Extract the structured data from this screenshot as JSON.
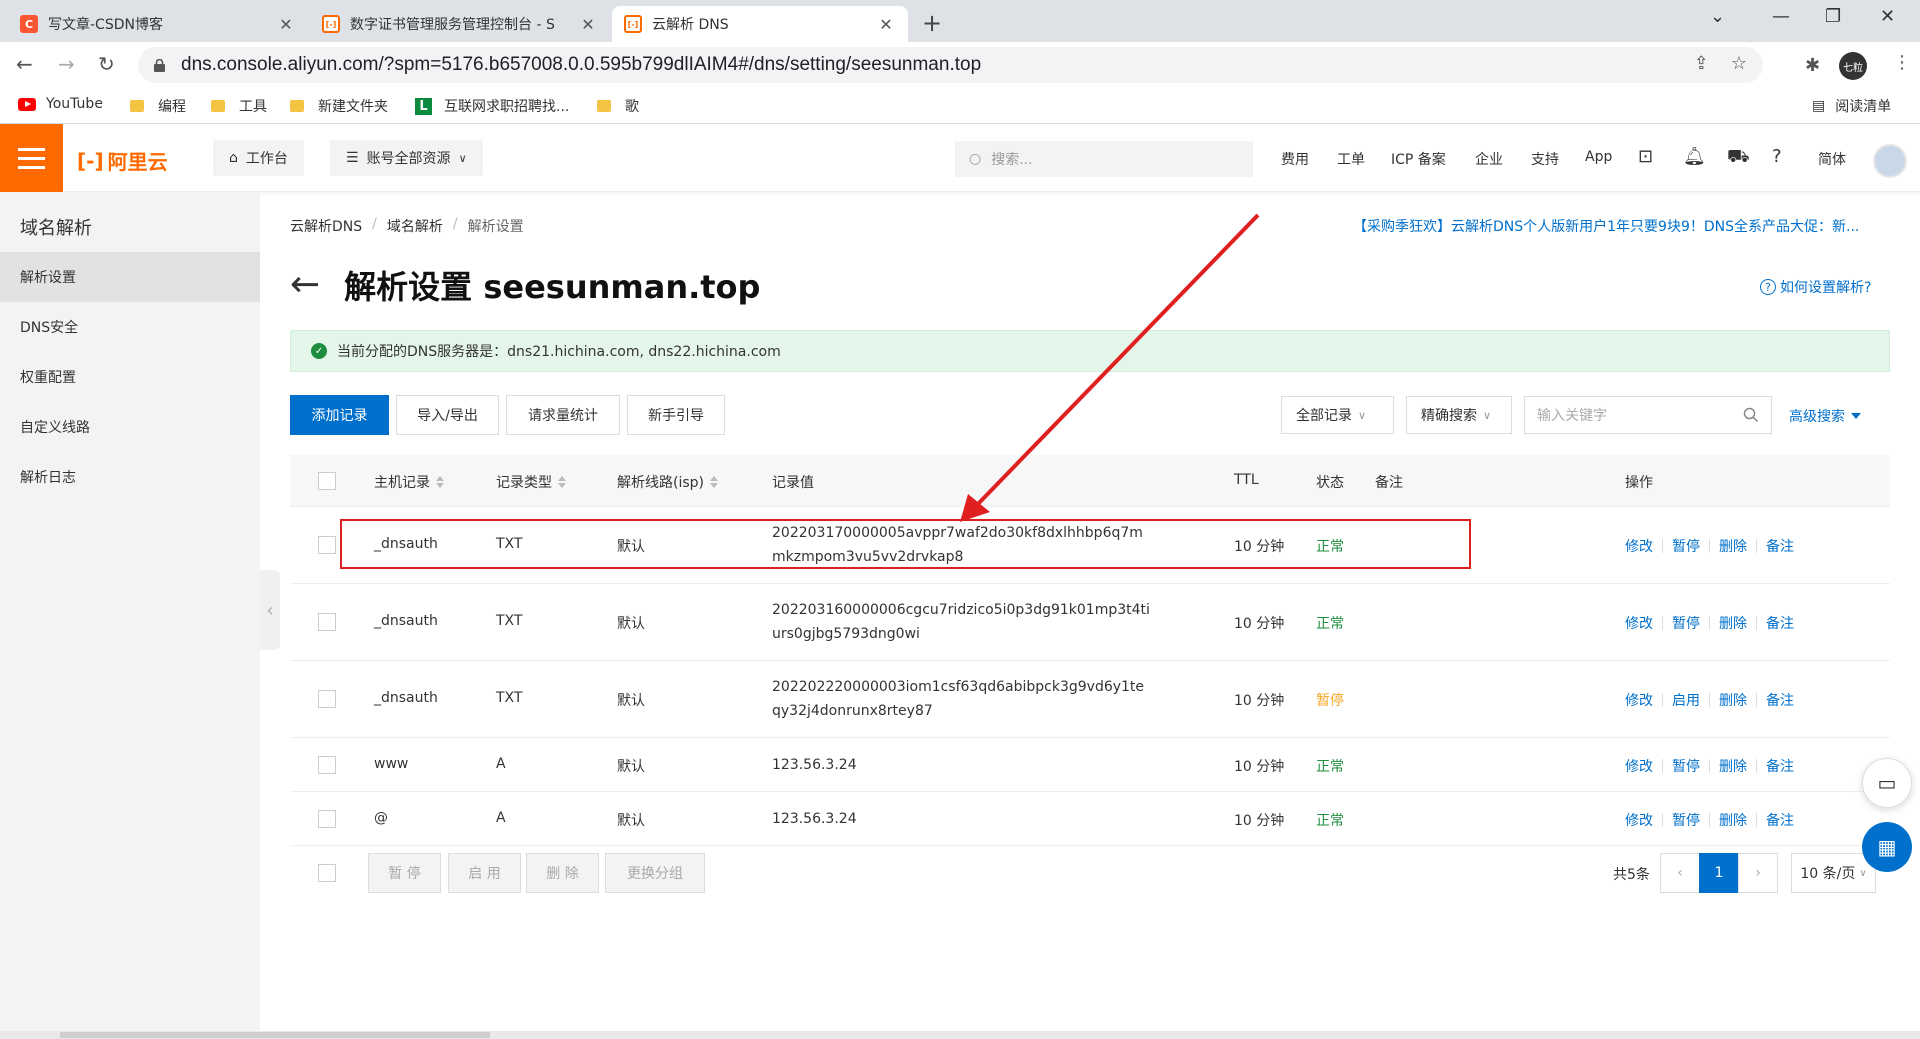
{
  "browser": {
    "tabs": [
      {
        "title": "写文章-CSDN博客",
        "favicon": "C"
      },
      {
        "title": "数字证书管理服务管理控制台 - S",
        "favicon": "[-]"
      },
      {
        "title": "云解析 DNS",
        "favicon": "[-]"
      }
    ],
    "url": "dns.console.aliyun.com/?spm=5176.b657008.0.0.595b799dlIAIM4#/dns/setting/seesunman.top",
    "profile_label": "七粒",
    "bookmarks": [
      "YouTube",
      "编程",
      "工具",
      "新建文件夹",
      "互联网求职招聘找...",
      "歌"
    ],
    "reading_list": "阅读清单"
  },
  "header": {
    "logo": "阿里云",
    "workbench": "工作台",
    "resources": "账号全部资源",
    "search_placeholder": "搜索...",
    "links": [
      "费用",
      "工单",
      "ICP 备案",
      "企业",
      "支持",
      "App"
    ],
    "lang": "简体"
  },
  "sidebar": {
    "title": "域名解析",
    "items": [
      {
        "label": "解析设置",
        "active": true
      },
      {
        "label": "DNS安全"
      },
      {
        "label": "权重配置"
      },
      {
        "label": "自定义线路"
      },
      {
        "label": "解析日志"
      }
    ]
  },
  "main": {
    "breadcrumb": [
      "云解析DNS",
      "域名解析",
      "解析设置"
    ],
    "promo": "【采购季狂欢】云解析DNS个人版新用户1年只要9块9！DNS全系产品大促：新...",
    "title": "解析设置 seesunman.top",
    "howto": "如何设置解析?",
    "notice": "当前分配的DNS服务器是：dns21.hichina.com, dns22.hichina.com",
    "toolbar": {
      "add": "添加记录",
      "import": "导入/导出",
      "stats": "请求量统计",
      "guide": "新手引导",
      "filter_all": "全部记录",
      "filter_mode": "精确搜索",
      "keyword_placeholder": "输入关键字",
      "advanced": "高级搜索"
    },
    "columns": {
      "host": "主机记录",
      "type": "记录类型",
      "line": "解析线路(isp)",
      "value": "记录值",
      "ttl": "TTL",
      "status": "状态",
      "remark": "备注",
      "ops": "操作"
    },
    "rows": [
      {
        "host": "_dnsauth",
        "type": "TXT",
        "line": "默认",
        "value": "202203170000005avppr7waf2do30kf8dxlhhbp6q7mmkzmpom3vu5vv2drvkap8",
        "ttl": "10 分钟",
        "status": "正常",
        "toggle": "暂停"
      },
      {
        "host": "_dnsauth",
        "type": "TXT",
        "line": "默认",
        "value": "202203160000006cgcu7ridzico5i0p3dg91k01mp3t4tiurs0gjbg5793dng0wi",
        "ttl": "10 分钟",
        "status": "正常",
        "toggle": "暂停"
      },
      {
        "host": "_dnsauth",
        "type": "TXT",
        "line": "默认",
        "value": "202202220000003iom1csf63qd6abibpck3g9vd6y1teqy32j4donrunx8rtey87",
        "ttl": "10 分钟",
        "status": "暂停",
        "toggle": "启用"
      },
      {
        "host": "www",
        "type": "A",
        "line": "默认",
        "value": "123.56.3.24",
        "ttl": "10 分钟",
        "status": "正常",
        "toggle": "暂停"
      },
      {
        "host": "@",
        "type": "A",
        "line": "默认",
        "value": "123.56.3.24",
        "ttl": "10 分钟",
        "status": "正常",
        "toggle": "暂停"
      }
    ],
    "op_labels": {
      "edit": "修改",
      "delete": "删除",
      "remark": "备注"
    },
    "bulk": [
      "暂 停",
      "启 用",
      "删 除",
      "更换分组"
    ],
    "pagination": {
      "total": "共5条",
      "current": "1",
      "page_size": "10 条/页"
    }
  },
  "colors": {
    "accent": "#ff6a00",
    "primary": "#0070cc",
    "ok": "#1e8e3e",
    "paused": "#f5a623",
    "highlight": "#e02020"
  }
}
